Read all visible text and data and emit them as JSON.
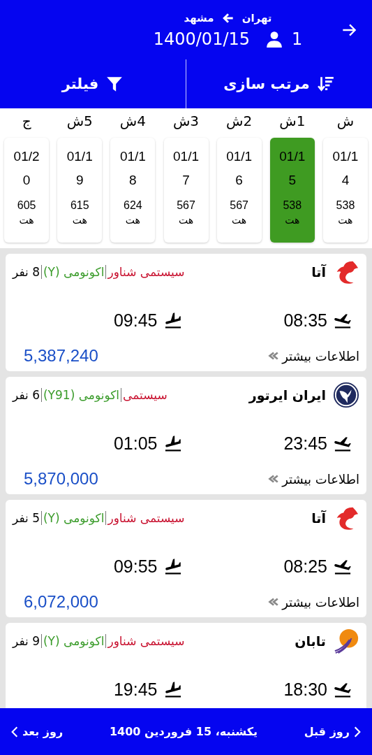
{
  "header": {
    "origin": "تهران",
    "destination": "مشهد",
    "passengers": "1",
    "date": "1400/01/15"
  },
  "toolbar": [
    {
      "kind": "sort",
      "label": "مرتب سازی"
    },
    {
      "kind": "filter",
      "label": "فیلتر"
    }
  ],
  "days": [
    {
      "weekday": "ش",
      "date": "01/14",
      "price": "538",
      "unit": "هت",
      "selected": false
    },
    {
      "weekday": "1ش",
      "date": "01/15",
      "price": "538",
      "unit": "هت",
      "selected": true
    },
    {
      "weekday": "2ش",
      "date": "01/16",
      "price": "567",
      "unit": "هت",
      "selected": false
    },
    {
      "weekday": "3ش",
      "date": "01/17",
      "price": "567",
      "unit": "هت",
      "selected": false
    },
    {
      "weekday": "4ش",
      "date": "01/18",
      "price": "624",
      "unit": "هت",
      "selected": false
    },
    {
      "weekday": "5ش",
      "date": "01/19",
      "price": "615",
      "unit": "هت",
      "selected": false
    },
    {
      "weekday": "ج",
      "date": "01/20",
      "price": "605",
      "unit": "هت",
      "selected": false
    }
  ],
  "flights": [
    {
      "kind": "red_bird",
      "airline": "آتا",
      "type": "سیستمی شناور",
      "class": "اکونومی (Y)",
      "seats": "8 نفر",
      "departure": "08:35",
      "arrival": "09:45",
      "more_info": "اطلاعات بیشتر",
      "price": "5,387,240"
    },
    {
      "kind": "bird_circle",
      "airline": "ایران ایرتور",
      "type": "سیستمی",
      "class": "اکونومی (Y91)",
      "seats": "6 نفر",
      "departure": "23:45",
      "arrival": "01:05",
      "more_info": "اطلاعات بیشتر",
      "price": "5,870,000"
    },
    {
      "kind": "red_bird",
      "airline": "آتا",
      "type": "سیستمی شناور",
      "class": "اکونومی (Y)",
      "seats": "5 نفر",
      "departure": "08:25",
      "arrival": "09:55",
      "more_info": "اطلاعات بیشتر",
      "price": "6,072,000"
    },
    {
      "kind": "sun",
      "airline": "تابان",
      "type": "سیستمی شناور",
      "class": "اکونومی (Y)",
      "seats": "9 نفر",
      "departure": "18:30",
      "arrival": "19:45"
    }
  ],
  "footer": {
    "previous": "روز قبل",
    "date": "یکشنبه، 15 فروردین 1400",
    "next": "روز بعد"
  }
}
